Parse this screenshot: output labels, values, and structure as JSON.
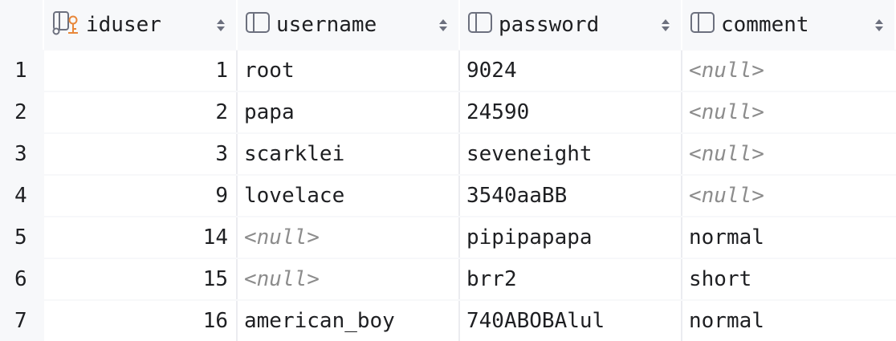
{
  "columns": {
    "iduser": "iduser",
    "username": "username",
    "password": "password",
    "comment": "comment"
  },
  "rows": [
    {
      "num": "1",
      "iduser": "1",
      "username": "root",
      "password": "9024",
      "comment": "<null>"
    },
    {
      "num": "2",
      "iduser": "2",
      "username": "papa",
      "password": "24590",
      "comment": "<null>"
    },
    {
      "num": "3",
      "iduser": "3",
      "username": "scarklei",
      "password": "seveneight",
      "comment": "<null>"
    },
    {
      "num": "4",
      "iduser": "9",
      "username": "lovelace",
      "password": "3540aaBB",
      "comment": "<null>"
    },
    {
      "num": "5",
      "iduser": "14",
      "username": "<null>",
      "password": "pipipapapa",
      "comment": "normal"
    },
    {
      "num": "6",
      "iduser": "15",
      "username": "<null>",
      "password": "brr2",
      "comment": "short"
    },
    {
      "num": "7",
      "iduser": "16",
      "username": "american_boy",
      "password": "740ABOBAlul",
      "comment": "normal"
    }
  ],
  "icons": {
    "key_column": "primary-key-column-icon",
    "column": "column-icon",
    "sort": "sort-arrows-icon"
  },
  "colors": {
    "header_bg": "#f7f8fa",
    "cell_bg": "#ffffff",
    "null_text": "#8c8c8c",
    "key_icon_accent": "#e8873a"
  }
}
